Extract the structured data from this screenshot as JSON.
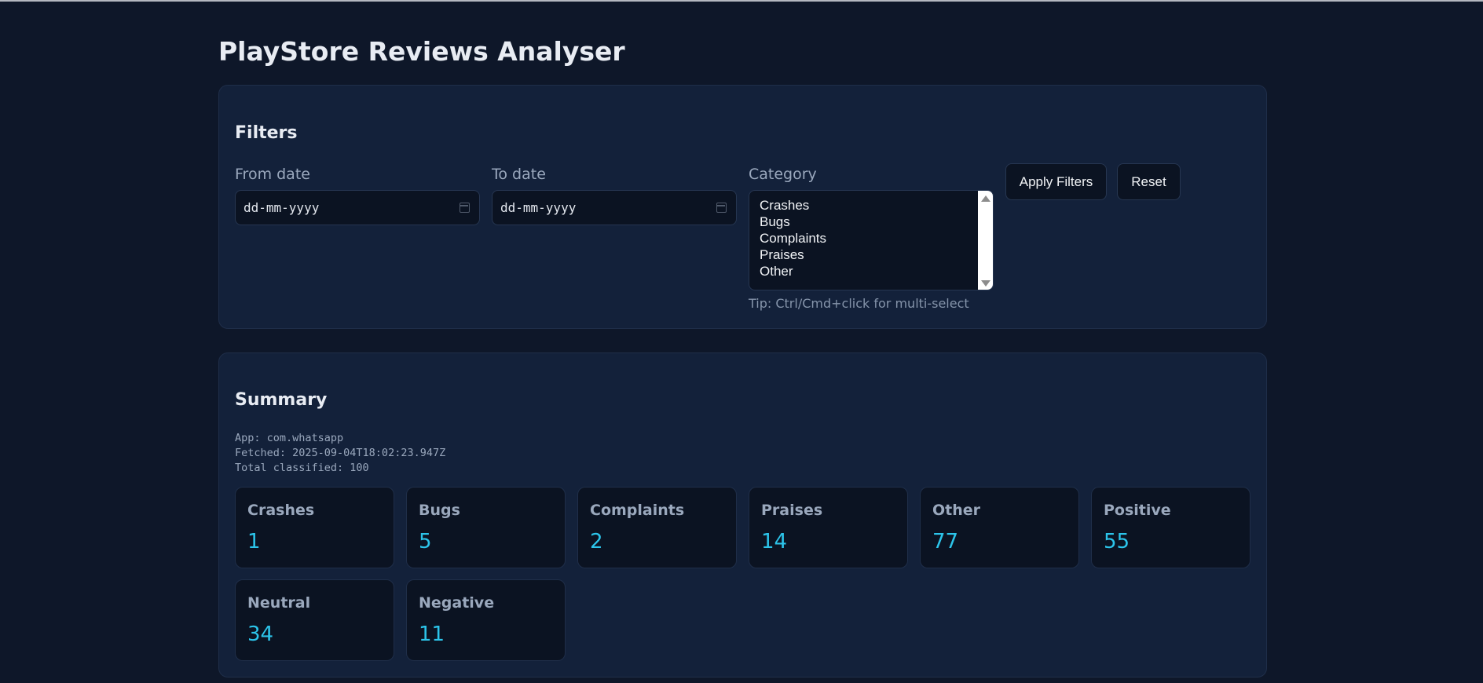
{
  "app": {
    "title": "PlayStore Reviews Analyser"
  },
  "filters": {
    "heading": "Filters",
    "from_date": {
      "label": "From date",
      "placeholder": "dd-mm-yyyy"
    },
    "to_date": {
      "label": "To date",
      "placeholder": "dd-mm-yyyy"
    },
    "category": {
      "label": "Category",
      "options": [
        "Crashes",
        "Bugs",
        "Complaints",
        "Praises",
        "Other"
      ],
      "tip": "Tip: Ctrl/Cmd+click for multi-select"
    },
    "apply_label": "Apply Filters",
    "reset_label": "Reset"
  },
  "summary": {
    "heading": "Summary",
    "app_line": "App: com.whatsapp",
    "fetched_line": "Fetched: 2025-09-04T18:02:23.947Z",
    "total_line": "Total classified: 100",
    "stats": [
      {
        "label": "Crashes",
        "value": "1"
      },
      {
        "label": "Bugs",
        "value": "5"
      },
      {
        "label": "Complaints",
        "value": "2"
      },
      {
        "label": "Praises",
        "value": "14"
      },
      {
        "label": "Other",
        "value": "77"
      },
      {
        "label": "Positive",
        "value": "55"
      },
      {
        "label": "Neutral",
        "value": "34"
      },
      {
        "label": "Negative",
        "value": "11"
      }
    ]
  },
  "icons": {
    "date_picker": "calendar-icon",
    "scroll_up": "scroll-up-arrow-icon",
    "scroll_down": "scroll-down-arrow-icon"
  },
  "colors": {
    "background": "#0e1729",
    "card": "#13213a",
    "accent_value": "#2cc4ea",
    "label": "#9aa8bd"
  }
}
